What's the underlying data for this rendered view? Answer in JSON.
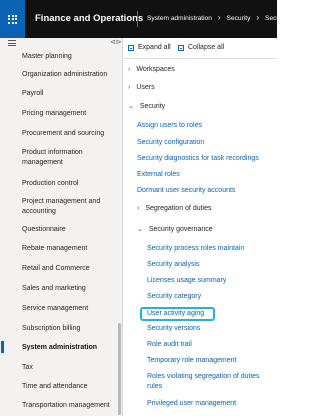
{
  "app": {
    "title": "Finance and Operations",
    "breadcrumb": [
      "System administration",
      "Security",
      "Securi"
    ]
  },
  "leftnav": {
    "items": [
      {
        "label": "Master planning"
      },
      {
        "label": "Organization administration"
      },
      {
        "label": "Payroll"
      },
      {
        "label": "Pricing management"
      },
      {
        "label": "Procurement and sourcing"
      },
      {
        "label": "Product information management"
      },
      {
        "label": "Production control"
      },
      {
        "label": "Project management and accounting"
      },
      {
        "label": "Questionnaire"
      },
      {
        "label": "Rebate management"
      },
      {
        "label": "Retail and Commerce"
      },
      {
        "label": "Sales and marketing"
      },
      {
        "label": "Service management"
      },
      {
        "label": "Subscription billing"
      },
      {
        "label": "System administration",
        "active": true
      },
      {
        "label": "Tax"
      },
      {
        "label": "Time and attendance"
      },
      {
        "label": "Transportation management"
      }
    ]
  },
  "content": {
    "expand_all": "Expand all",
    "collapse_all": "Collapse all",
    "sections": {
      "workspaces": "Workspaces",
      "users": "Users",
      "security": "Security"
    },
    "security_links": [
      "Assign users to roles",
      "Security configuration",
      "Security diagnostics for task recordings",
      "External roles",
      "Dormant user security accounts"
    ],
    "segregation_of_duties": "Segregation of duties",
    "security_governance": "Security governance",
    "governance_links": [
      "Security process roles maintain",
      "Security analysis",
      "Licenses usage summary",
      "Security category",
      "User activity aging",
      "Security versions",
      "Role audit trail",
      "Temporary role management",
      "Roles violating segregation of duties rules",
      "Privileged user management"
    ],
    "highlighted_link": "User activity aging"
  },
  "colors": {
    "accent": "#0a62b4",
    "topbar": "#111111",
    "highlight": "#2ab0d8"
  },
  "icons": [
    "waffle-icon",
    "hamburger-icon",
    "pin-icon",
    "expand-all-icon",
    "collapse-all-icon",
    "chevron-right-icon",
    "chevron-down-icon"
  ]
}
